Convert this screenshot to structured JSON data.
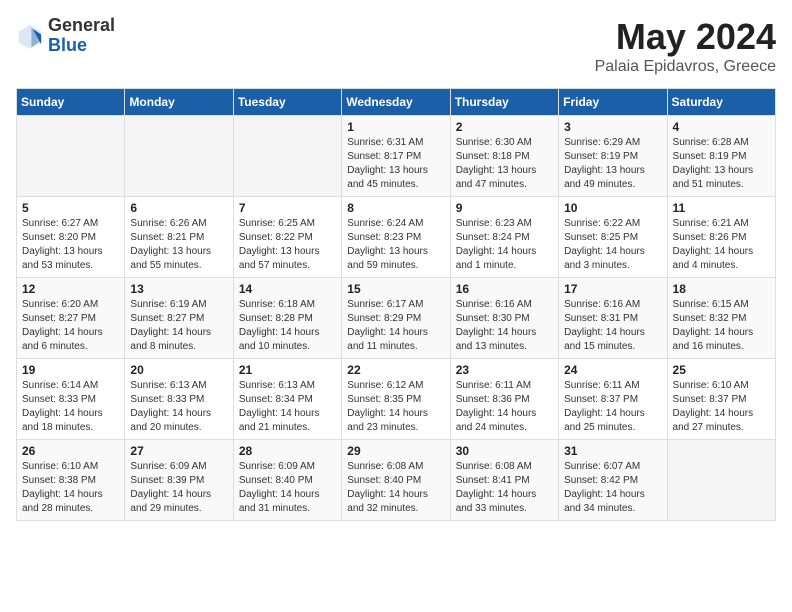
{
  "logo": {
    "general": "General",
    "blue": "Blue"
  },
  "title": {
    "month": "May 2024",
    "location": "Palaia Epidavros, Greece"
  },
  "weekdays": [
    "Sunday",
    "Monday",
    "Tuesday",
    "Wednesday",
    "Thursday",
    "Friday",
    "Saturday"
  ],
  "weeks": [
    [
      {
        "day": "",
        "content": ""
      },
      {
        "day": "",
        "content": ""
      },
      {
        "day": "",
        "content": ""
      },
      {
        "day": "1",
        "content": "Sunrise: 6:31 AM\nSunset: 8:17 PM\nDaylight: 13 hours\nand 45 minutes."
      },
      {
        "day": "2",
        "content": "Sunrise: 6:30 AM\nSunset: 8:18 PM\nDaylight: 13 hours\nand 47 minutes."
      },
      {
        "day": "3",
        "content": "Sunrise: 6:29 AM\nSunset: 8:19 PM\nDaylight: 13 hours\nand 49 minutes."
      },
      {
        "day": "4",
        "content": "Sunrise: 6:28 AM\nSunset: 8:19 PM\nDaylight: 13 hours\nand 51 minutes."
      }
    ],
    [
      {
        "day": "5",
        "content": "Sunrise: 6:27 AM\nSunset: 8:20 PM\nDaylight: 13 hours\nand 53 minutes."
      },
      {
        "day": "6",
        "content": "Sunrise: 6:26 AM\nSunset: 8:21 PM\nDaylight: 13 hours\nand 55 minutes."
      },
      {
        "day": "7",
        "content": "Sunrise: 6:25 AM\nSunset: 8:22 PM\nDaylight: 13 hours\nand 57 minutes."
      },
      {
        "day": "8",
        "content": "Sunrise: 6:24 AM\nSunset: 8:23 PM\nDaylight: 13 hours\nand 59 minutes."
      },
      {
        "day": "9",
        "content": "Sunrise: 6:23 AM\nSunset: 8:24 PM\nDaylight: 14 hours\nand 1 minute."
      },
      {
        "day": "10",
        "content": "Sunrise: 6:22 AM\nSunset: 8:25 PM\nDaylight: 14 hours\nand 3 minutes."
      },
      {
        "day": "11",
        "content": "Sunrise: 6:21 AM\nSunset: 8:26 PM\nDaylight: 14 hours\nand 4 minutes."
      }
    ],
    [
      {
        "day": "12",
        "content": "Sunrise: 6:20 AM\nSunset: 8:27 PM\nDaylight: 14 hours\nand 6 minutes."
      },
      {
        "day": "13",
        "content": "Sunrise: 6:19 AM\nSunset: 8:27 PM\nDaylight: 14 hours\nand 8 minutes."
      },
      {
        "day": "14",
        "content": "Sunrise: 6:18 AM\nSunset: 8:28 PM\nDaylight: 14 hours\nand 10 minutes."
      },
      {
        "day": "15",
        "content": "Sunrise: 6:17 AM\nSunset: 8:29 PM\nDaylight: 14 hours\nand 11 minutes."
      },
      {
        "day": "16",
        "content": "Sunrise: 6:16 AM\nSunset: 8:30 PM\nDaylight: 14 hours\nand 13 minutes."
      },
      {
        "day": "17",
        "content": "Sunrise: 6:16 AM\nSunset: 8:31 PM\nDaylight: 14 hours\nand 15 minutes."
      },
      {
        "day": "18",
        "content": "Sunrise: 6:15 AM\nSunset: 8:32 PM\nDaylight: 14 hours\nand 16 minutes."
      }
    ],
    [
      {
        "day": "19",
        "content": "Sunrise: 6:14 AM\nSunset: 8:33 PM\nDaylight: 14 hours\nand 18 minutes."
      },
      {
        "day": "20",
        "content": "Sunrise: 6:13 AM\nSunset: 8:33 PM\nDaylight: 14 hours\nand 20 minutes."
      },
      {
        "day": "21",
        "content": "Sunrise: 6:13 AM\nSunset: 8:34 PM\nDaylight: 14 hours\nand 21 minutes."
      },
      {
        "day": "22",
        "content": "Sunrise: 6:12 AM\nSunset: 8:35 PM\nDaylight: 14 hours\nand 23 minutes."
      },
      {
        "day": "23",
        "content": "Sunrise: 6:11 AM\nSunset: 8:36 PM\nDaylight: 14 hours\nand 24 minutes."
      },
      {
        "day": "24",
        "content": "Sunrise: 6:11 AM\nSunset: 8:37 PM\nDaylight: 14 hours\nand 25 minutes."
      },
      {
        "day": "25",
        "content": "Sunrise: 6:10 AM\nSunset: 8:37 PM\nDaylight: 14 hours\nand 27 minutes."
      }
    ],
    [
      {
        "day": "26",
        "content": "Sunrise: 6:10 AM\nSunset: 8:38 PM\nDaylight: 14 hours\nand 28 minutes."
      },
      {
        "day": "27",
        "content": "Sunrise: 6:09 AM\nSunset: 8:39 PM\nDaylight: 14 hours\nand 29 minutes."
      },
      {
        "day": "28",
        "content": "Sunrise: 6:09 AM\nSunset: 8:40 PM\nDaylight: 14 hours\nand 31 minutes."
      },
      {
        "day": "29",
        "content": "Sunrise: 6:08 AM\nSunset: 8:40 PM\nDaylight: 14 hours\nand 32 minutes."
      },
      {
        "day": "30",
        "content": "Sunrise: 6:08 AM\nSunset: 8:41 PM\nDaylight: 14 hours\nand 33 minutes."
      },
      {
        "day": "31",
        "content": "Sunrise: 6:07 AM\nSunset: 8:42 PM\nDaylight: 14 hours\nand 34 minutes."
      },
      {
        "day": "",
        "content": ""
      }
    ]
  ]
}
